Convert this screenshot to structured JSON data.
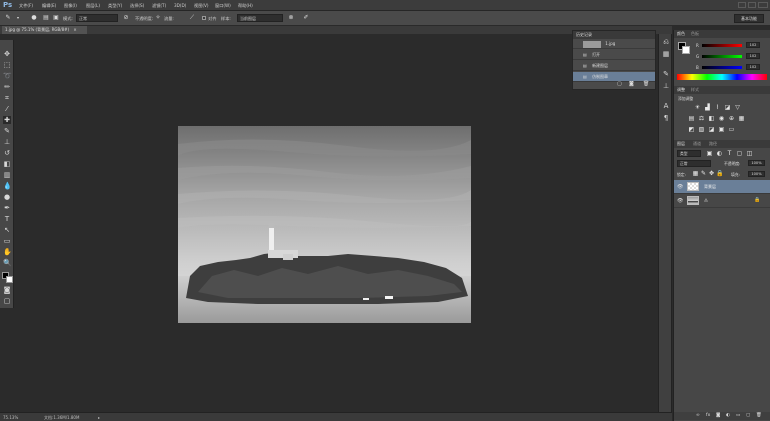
{
  "app": {
    "logo": "Ps"
  },
  "menu": [
    "文件(F)",
    "编辑(E)",
    "图像(I)",
    "图层(L)",
    "类型(Y)",
    "选择(S)",
    "滤镜(T)",
    "3D(D)",
    "视图(V)",
    "窗口(W)",
    "帮助(H)"
  ],
  "options": {
    "mode_label": "模式:",
    "mode_value": "正常",
    "opacity_label": "不透明度:",
    "opacity_value": "100%",
    "flow_label": "流量:",
    "flow_value": "100%",
    "align_label": "对齐",
    "sample_label": "样本:",
    "sample_value": "当前图层",
    "workspace": "基本功能"
  },
  "document": {
    "tab": "1.jpg @ 75.1% (背景层, RGB/8#)"
  },
  "history": {
    "tabs": [
      "历史记录"
    ],
    "snapshot": "1.jpg",
    "items": [
      "打开",
      "新建图层",
      "仿制图章"
    ]
  },
  "color": {
    "tabs": [
      "颜色",
      "色板"
    ],
    "r_label": "R",
    "g_label": "G",
    "b_label": "B",
    "r_value": "102",
    "g_value": "102",
    "b_value": "102"
  },
  "adjustments": {
    "tabs": [
      "调整",
      "样式"
    ],
    "title": "添加调整"
  },
  "layers": {
    "tabs": [
      "图层",
      "通道",
      "路径"
    ],
    "filter_value": "类型",
    "blend_value": "正常",
    "opacity_label": "不透明度:",
    "opacity_value": "100%",
    "lock_label": "锁定:",
    "fill_label": "填充:",
    "fill_value": "100%",
    "items": [
      {
        "name": "背景层",
        "selected": true
      },
      {
        "name": "",
        "selected": false
      }
    ]
  },
  "status": {
    "zoom": "75.13%",
    "doc": "文档:1.36M/1.80M"
  }
}
